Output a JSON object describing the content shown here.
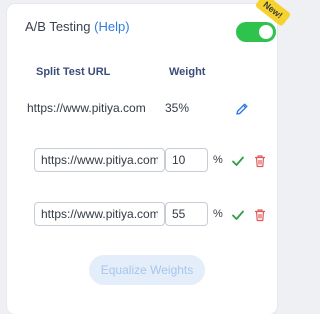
{
  "header": {
    "title": "A/B Testing",
    "help_label": "(Help)",
    "badge": "New!",
    "toggle_on": true
  },
  "columns": {
    "url": "Split Test URL",
    "weight": "Weight"
  },
  "primary_row": {
    "url": "https://www.pitiya.com",
    "weight": "35%"
  },
  "rows": [
    {
      "url": "https://www.pitiya.com/blog",
      "weight": "10"
    },
    {
      "url": "https://www.pitiya.com/new",
      "weight": "55"
    }
  ],
  "percent_symbol": "%",
  "equalize_label": "Equalize Weights",
  "colors": {
    "toggle": "#2fc24d",
    "badge": "#f6d22e",
    "link": "#2f7be3",
    "check": "#2e9e45",
    "trash": "#e05a5a"
  },
  "icons": {
    "edit": "pencil-icon",
    "confirm": "check-icon",
    "delete": "trash-icon"
  }
}
